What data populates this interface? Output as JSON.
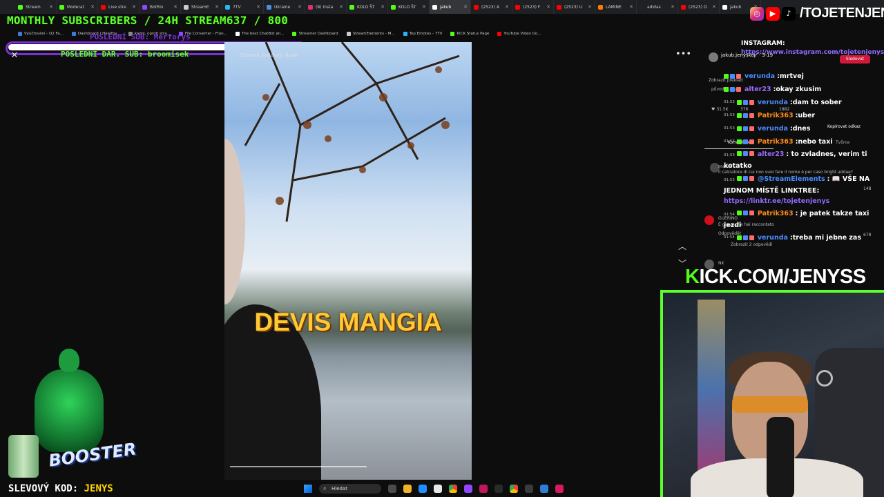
{
  "browser": {
    "tabs": [
      {
        "label": "Stream",
        "color": "#53fc18",
        "active": false
      },
      {
        "label": "Moderat",
        "color": "#53fc18",
        "active": false
      },
      {
        "label": "Live stre",
        "color": "#ff0000",
        "active": false
      },
      {
        "label": "BotRix",
        "color": "#9147ff",
        "active": false
      },
      {
        "label": "StreamE",
        "color": "#cccccc",
        "active": false
      },
      {
        "label": "7TV",
        "color": "#29b6f6",
        "active": false
      },
      {
        "label": "Ukraine",
        "color": "#4a90e2",
        "active": false
      },
      {
        "label": "(8) Insta",
        "color": "#e1306c",
        "active": false
      },
      {
        "label": "KOLO ŠT",
        "color": "#53fc18",
        "active": false
      },
      {
        "label": "KOLO ŠT",
        "color": "#53fc18",
        "active": false
      },
      {
        "label": "jakub",
        "color": "#ffffff",
        "active": true
      },
      {
        "label": "(2523) A",
        "color": "#ff0000",
        "active": false
      },
      {
        "label": "(2523) F",
        "color": "#ff0000",
        "active": false
      },
      {
        "label": "(2523) U",
        "color": "#ff0000",
        "active": false
      },
      {
        "label": "LAMINE",
        "color": "#ff7a00",
        "active": false
      },
      {
        "label": "adidas",
        "color": "#222222",
        "active": false
      },
      {
        "label": "(2523) D",
        "color": "#ff0000",
        "active": false
      },
      {
        "label": "jakub",
        "color": "#ffffff",
        "active": false
      }
    ],
    "bookmarks": [
      {
        "label": "Vyúčtování - O2 Fa...",
        "color": "#3a7bd5"
      },
      {
        "label": "Dashboard | Healthy...",
        "color": "#3a7bd5"
      },
      {
        "label": "kaobi, oproti stra...",
        "color": "#8a8a8a"
      },
      {
        "label": "File Converter - Fran...",
        "color": "#9147ff"
      },
      {
        "label": "The best ChatBot an...",
        "color": "#ffffff"
      },
      {
        "label": "Streamer Dashboard",
        "color": "#53fc18"
      },
      {
        "label": "StreamElements - M...",
        "color": "#cccccc"
      },
      {
        "label": "Top Emotes - 7TV",
        "color": "#29b6f6"
      },
      {
        "label": "KICK Status Page",
        "color": "#53fc18"
      },
      {
        "label": "YouTube Video Do...",
        "color": "#ff0000"
      }
    ]
  },
  "overlay": {
    "banner": "MONTHLY SUBSCRIBERS / 24H STREAM637 / 800",
    "last_sub": "POSLEDNÍ SUB: Merforys",
    "last_donation": "POSLEDNÍ DAR. SUB: broomisek",
    "promo_label": "SLEVOVÝ KOD:",
    "promo_code": "JENYS",
    "kick_prefix": "K",
    "kick_rest": "ICK.COM/JENYSS",
    "handle": "/TOJETENJENYS",
    "brand_logo": "BOOSTER"
  },
  "video": {
    "title": "Zobrazit podobný obsah",
    "caption": "DEVIS MANGIA",
    "progress": 0.55
  },
  "chat": {
    "instagram_label": "INSTAGRAM:",
    "instagram_link": "https://www.instagram.com/tojetenjenys",
    "follow_label": "Sledovat",
    "messages": [
      {
        "user": "verunda",
        "color": "#4a8bff",
        "text": "mrtvej",
        "time": ""
      },
      {
        "user": "alter23",
        "color": "#9c6bff",
        "text": "okay zkusim",
        "time": ""
      },
      {
        "user": "verunda",
        "color": "#4a8bff",
        "text": "dam to sober",
        "time": "01:53"
      },
      {
        "user": "Patrik363",
        "color": "#ff8c1a",
        "text": "uber",
        "time": "01:53"
      },
      {
        "user": "verunda",
        "color": "#4a8bff",
        "text": "dnes",
        "time": "01:53"
      },
      {
        "user": "Patrik363",
        "color": "#ff8c1a",
        "text": "nebo taxi",
        "time": "01:53"
      },
      {
        "user": "alter23",
        "color": "#9c6bff",
        "text": "to zvladnes, verim ti kotatko",
        "time": "01:53"
      },
      {
        "user": "@StreamElements",
        "color": "#4a8bff",
        "text": "📖 VŠE NA JEDNOM MÍSTĚ LINKTREE:",
        "link": "https://linktr.ee/tojetenjenys",
        "time": "01:53"
      },
      {
        "user": "Patrik363",
        "color": "#ff8c1a",
        "text": "je patek takze taxi jezdi",
        "time": "01:54"
      },
      {
        "user": "verunda",
        "color": "#4a8bff",
        "text": "treba mi jebne zas",
        "time": "01:54"
      }
    ],
    "ghost": {
      "account": "jakub.jenyskojr · 3-19",
      "translate": "Zobrazit překlad",
      "sound": "původní zvuk",
      "likes": "31.5K",
      "comments": "376",
      "shares": "1882",
      "copy_link": "Kopírovat odkaz",
      "comments_tab": "Komentáře",
      "creator_tab": "Tvůrce",
      "c1_user": "maxxx",
      "c1_text": "il calciatore di cui non vuoi fare il nome è per caso bright addae?",
      "c1_likes": "148",
      "c2_user": "GUERINO",
      "c2_text": "È grave che hai raccontato",
      "c2_likes": "678",
      "reply": "Odpovědět",
      "show_replies": "Zobrazit 2 odpovědí",
      "c3_user": "NK"
    }
  },
  "taskbar": {
    "search_placeholder": "Hledat"
  },
  "colors": {
    "kick_green": "#53fc18",
    "accent_purple": "#7d2fd6",
    "caption_yellow": "#ffc933"
  }
}
